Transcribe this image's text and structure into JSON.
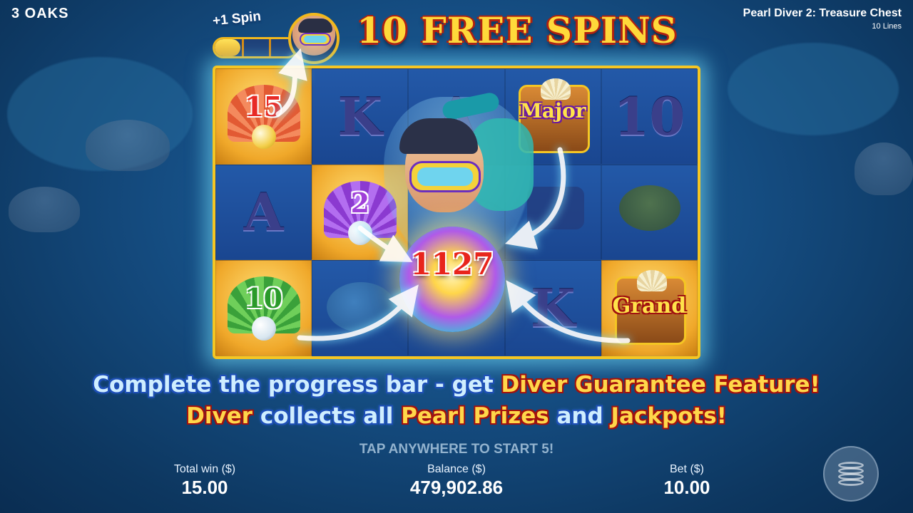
{
  "header": {
    "brand": "3 OAKS",
    "game_name": "Pearl Diver 2: Treasure Chest",
    "lines": "10 Lines"
  },
  "banner": {
    "text": "10 FREE SPINS"
  },
  "progress": {
    "label": "+1 Spin",
    "fill_fraction": 0.32,
    "avatar_icon": "diver-avatar-icon"
  },
  "reels": {
    "cells": [
      {
        "type": "pearl-shell",
        "value": "15",
        "color": "red"
      },
      {
        "type": "letter",
        "value": "K"
      },
      {
        "type": "letter",
        "value": "A"
      },
      {
        "type": "chest",
        "value": "Major"
      },
      {
        "type": "letter",
        "value": "10"
      },
      {
        "type": "letter",
        "value": "A"
      },
      {
        "type": "pearl-shell",
        "value": "2",
        "color": "purple"
      },
      {
        "type": "symbol",
        "value": "diver"
      },
      {
        "type": "symbol",
        "value": "goggles"
      },
      {
        "type": "symbol",
        "value": "turtle"
      },
      {
        "type": "pearl-shell",
        "value": "10",
        "color": "green"
      },
      {
        "type": "symbol",
        "value": "dolphin"
      },
      {
        "type": "symbol",
        "value": "fins"
      },
      {
        "type": "letter",
        "value": "K"
      },
      {
        "type": "chest",
        "value": "Grand"
      }
    ]
  },
  "collect": {
    "value": "1127"
  },
  "message": {
    "line1_part1": "Complete the progress bar - get",
    "line1_part2": "Diver Guarantee Feature!",
    "line2_part1": "Diver",
    "line2_part2": "collects all",
    "line2_part3": "Pearl Prizes",
    "line2_part4": "and",
    "line2_part5": "Jackpots!"
  },
  "tap_prompt": "TAP ANYWHERE TO START 5!",
  "stats": {
    "total_win_label": "Total win ($)",
    "total_win_value": "15.00",
    "balance_label": "Balance ($)",
    "balance_value": "479,902.86",
    "bet_label": "Bet ($)",
    "bet_value": "10.00"
  },
  "controls": {
    "stack_icon": "coin-stack-icon"
  },
  "colors": {
    "accent_gold": "#f5c623",
    "banner_red": "#b02010",
    "glow": "#78e6ff"
  }
}
